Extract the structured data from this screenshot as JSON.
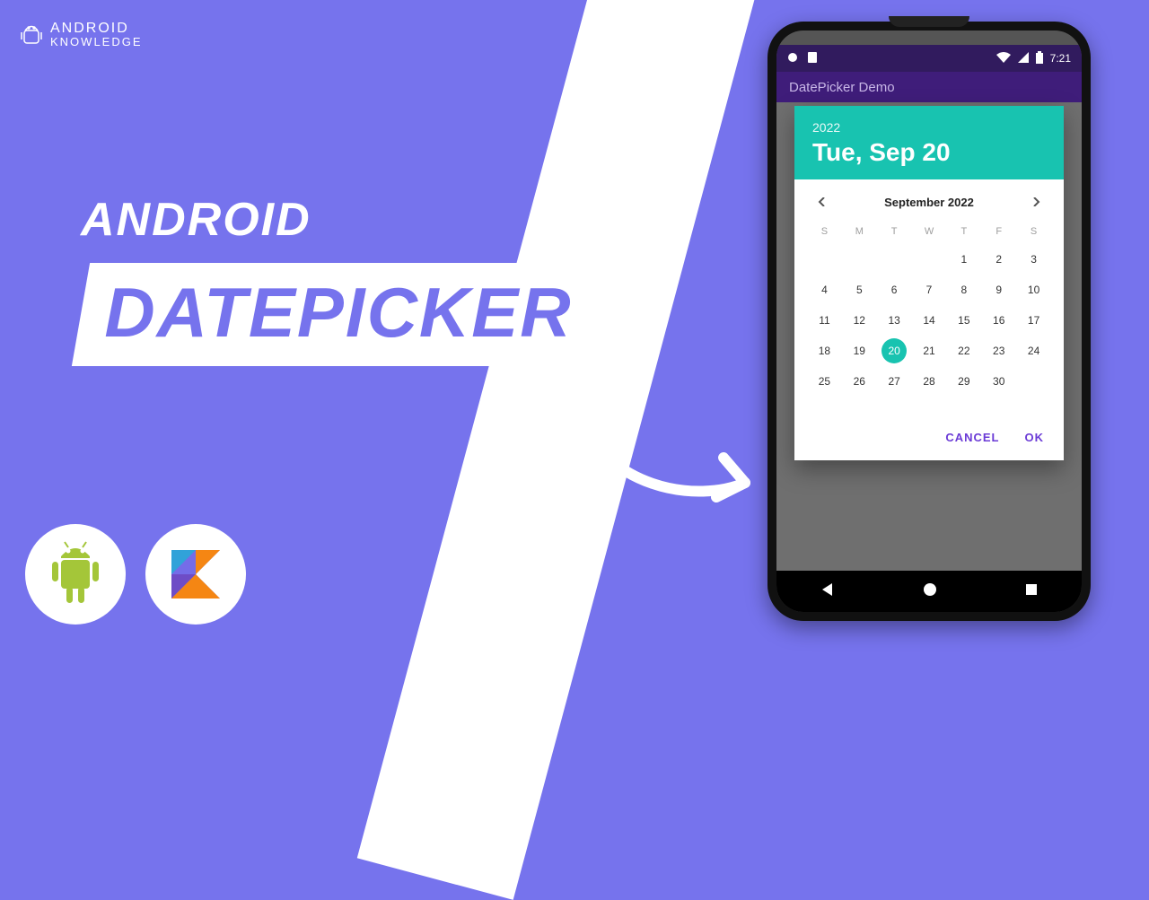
{
  "brand": {
    "line1": "ANDROID",
    "line2": "KNOWLEDGE"
  },
  "title": {
    "small": "ANDROID",
    "big": "DATEPICKER"
  },
  "phone": {
    "status": {
      "time": "7:21"
    },
    "app_bar_title": "DatePicker Demo",
    "datepicker": {
      "year": "2022",
      "header_date": "Tue, Sep 20",
      "month_label": "September 2022",
      "dow": [
        "S",
        "M",
        "T",
        "W",
        "T",
        "F",
        "S"
      ],
      "leading_blanks": 4,
      "days_in_month": 30,
      "selected_day": 20,
      "cancel": "CANCEL",
      "ok": "OK"
    }
  }
}
